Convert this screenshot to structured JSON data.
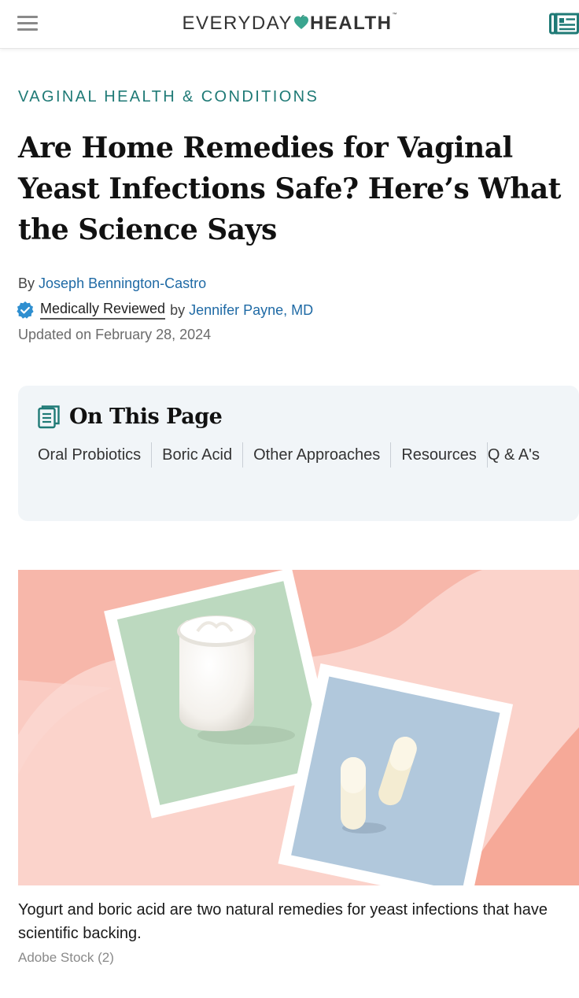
{
  "header": {
    "logo_word1": "EVERYDAY",
    "logo_word2": "HEALTH",
    "logo_tm": "™",
    "menu_icon": "hamburger-menu-icon",
    "news_icon": "newspaper-icon"
  },
  "article": {
    "category": "VAGINAL HEALTH & CONDITIONS",
    "title": "Are Home Remedies for Vaginal Yeast Infections Safe? Here’s What the Science Says",
    "byline": {
      "by_label": "By",
      "author": "Joseph Bennington-Castro",
      "reviewed_label": "Medically Reviewed",
      "reviewed_by_label": "by",
      "reviewer": "Jennifer Payne, MD",
      "updated": "Updated on February 28, 2024"
    }
  },
  "toc": {
    "title": "On This Page",
    "items": [
      "Oral Probiotics",
      "Boric Acid",
      "Other Approaches",
      "Resources",
      "Q & A's"
    ]
  },
  "hero": {
    "caption": "Yogurt and boric acid are two natural remedies for yeast infections that have scientific backing.",
    "credit": "Adobe Stock (2)"
  },
  "colors": {
    "accent_teal": "#1f7a76",
    "link_blue": "#1f6aa5",
    "logo_heart": "#3aa58f",
    "toc_bg": "#f1f5f8"
  }
}
